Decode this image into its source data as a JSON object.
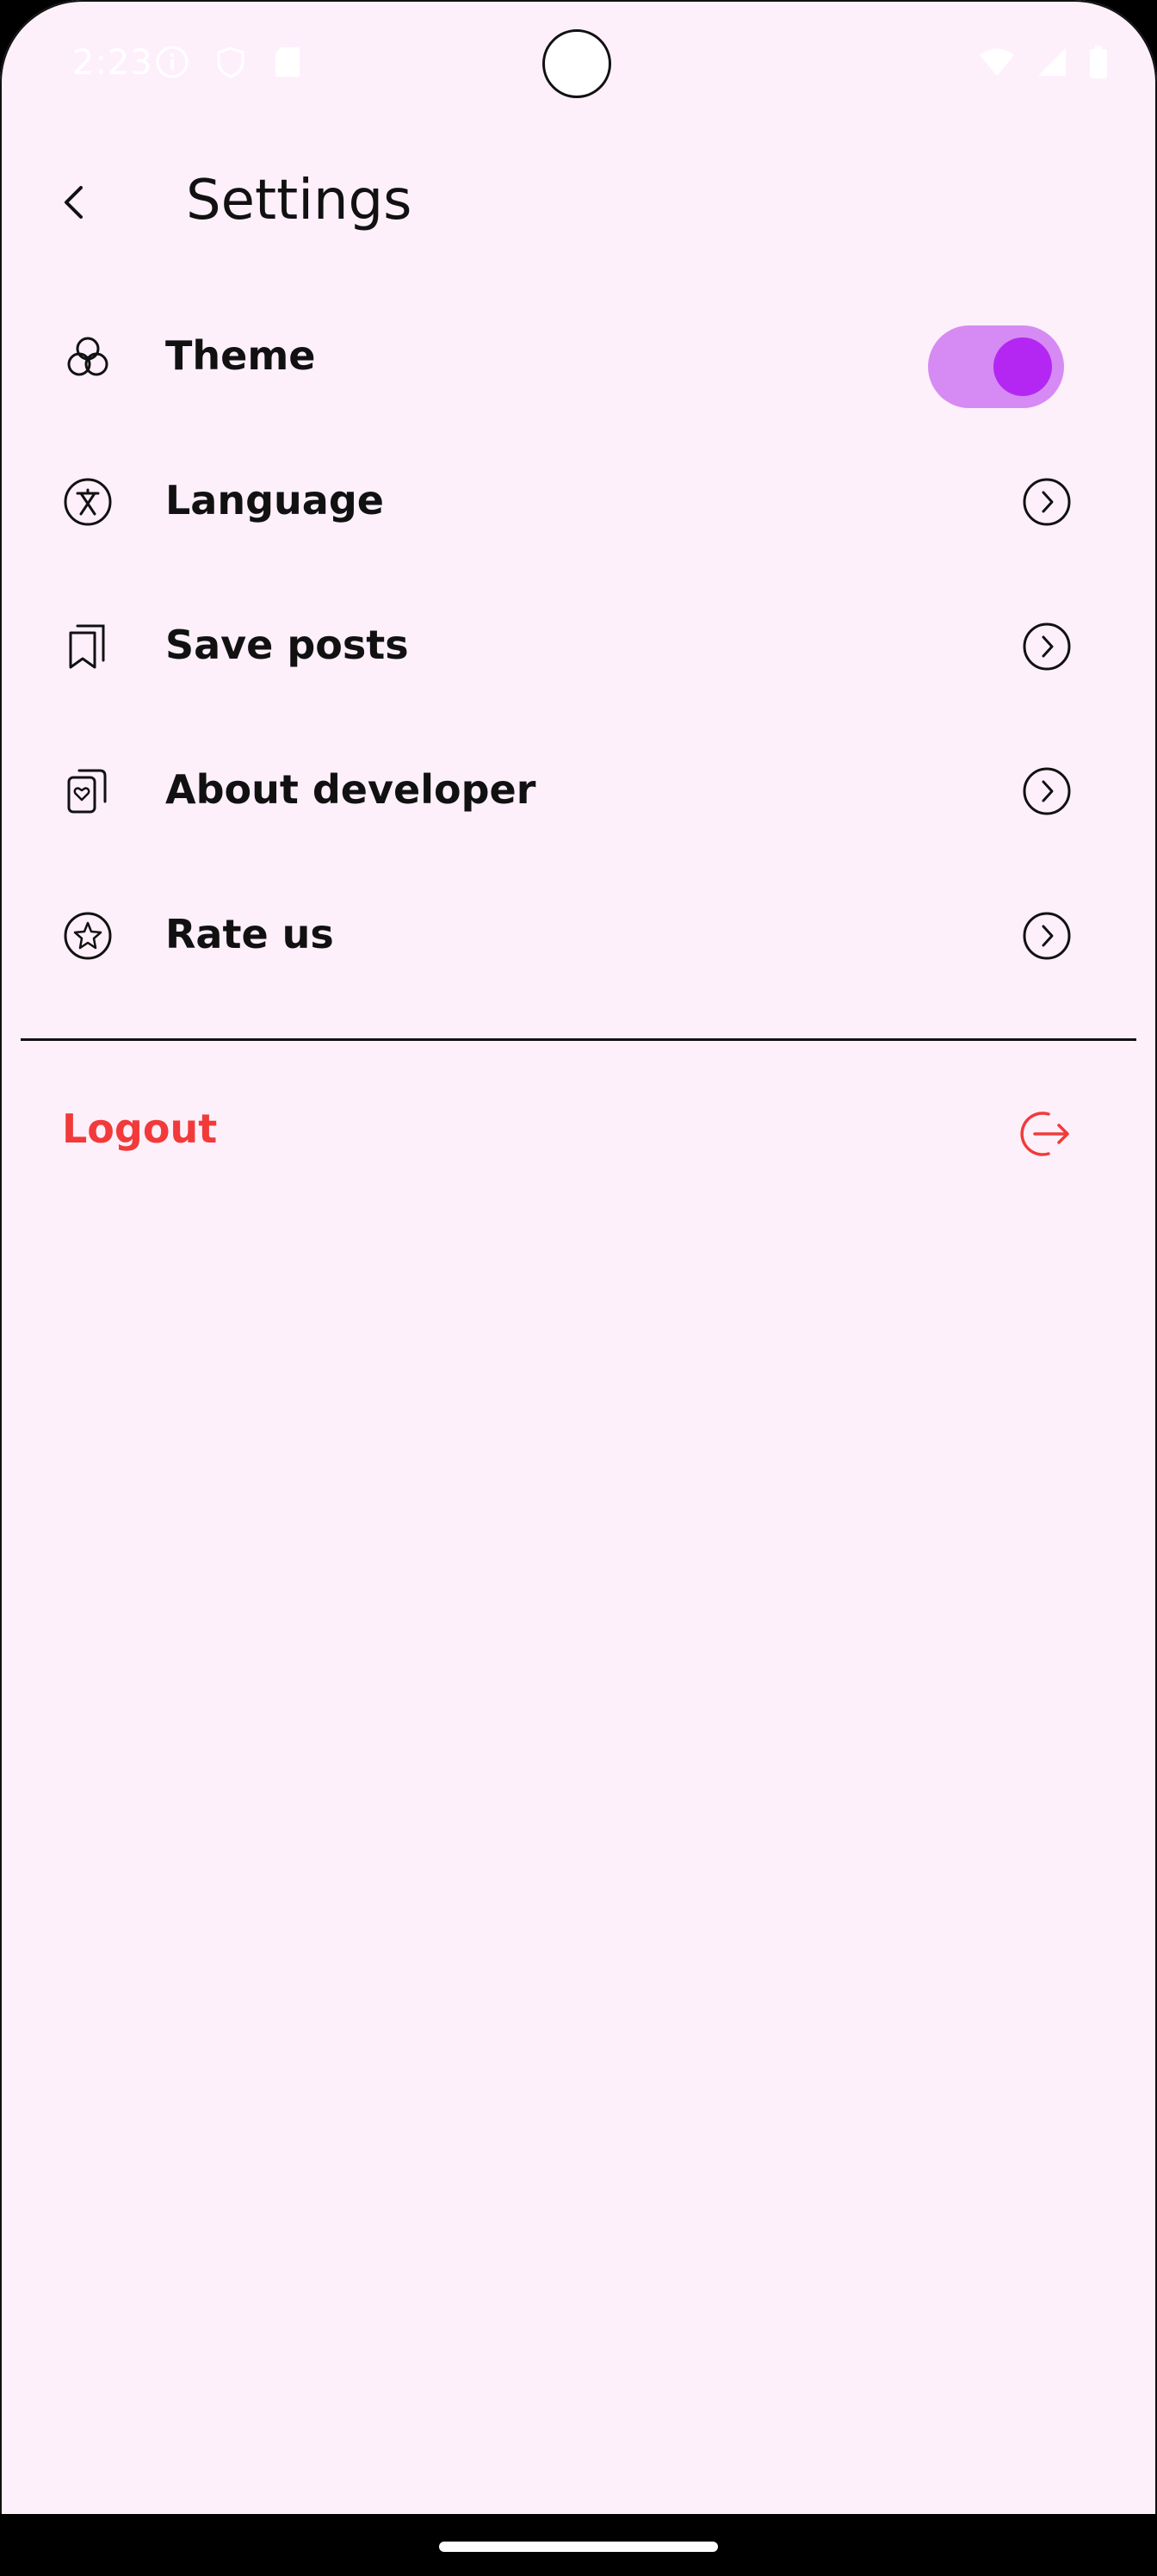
{
  "status_bar": {
    "time": "2:23"
  },
  "header": {
    "title": "Settings"
  },
  "settings": {
    "theme": {
      "label": "Theme",
      "icon": "palette-circles-icon",
      "toggle_on": true
    },
    "language": {
      "label": "Language",
      "icon": "translate-icon"
    },
    "save_posts": {
      "label": "Save posts",
      "icon": "bookmarks-icon"
    },
    "about": {
      "label": "About developer",
      "icon": "cards-heart-icon"
    },
    "rate": {
      "label": "Rate us",
      "icon": "star-circle-icon"
    }
  },
  "logout": {
    "label": "Logout",
    "icon": "logout-icon"
  },
  "colors": {
    "background": "#FDF0FB",
    "toggle_track": "#D58BF3",
    "toggle_knob": "#B427F2",
    "logout": "#F23A3A"
  }
}
